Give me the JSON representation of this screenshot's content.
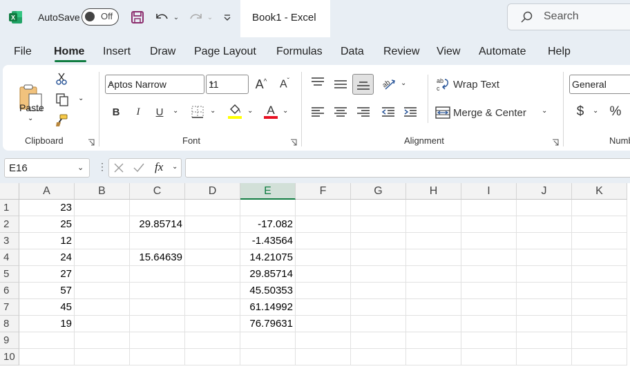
{
  "titlebar": {
    "autosave_label": "AutoSave",
    "autosave_state": "Off",
    "doc_title": "Book1  -  Excel",
    "search_placeholder": "Search"
  },
  "menu": [
    "File",
    "Home",
    "Insert",
    "Draw",
    "Page Layout",
    "Formulas",
    "Data",
    "Review",
    "View",
    "Automate",
    "Help"
  ],
  "menu_active": "Home",
  "ribbon": {
    "clipboard": {
      "paste_label": "Paste",
      "group_label": "Clipboard"
    },
    "font": {
      "font_name": "Aptos Narrow",
      "font_size": "11",
      "group_label": "Font",
      "bold": "B",
      "italic": "I",
      "underline": "U"
    },
    "alignment": {
      "wrap_text": "Wrap Text",
      "merge_center": "Merge & Center",
      "group_label": "Alignment"
    },
    "number": {
      "format": "General",
      "group_label": "Numb",
      "currency": "$",
      "percent": "%"
    }
  },
  "formula_bar": {
    "name_box": "E16",
    "formula": ""
  },
  "columns": [
    "A",
    "B",
    "C",
    "D",
    "E",
    "F",
    "G",
    "H",
    "I",
    "J",
    "K"
  ],
  "selected_column": "E",
  "rows": [
    "1",
    "2",
    "3",
    "4",
    "5",
    "6",
    "7",
    "8",
    "9",
    "10"
  ],
  "cells": {
    "A": [
      "23",
      "25",
      "12",
      "24",
      "27",
      "57",
      "45",
      "19",
      "",
      ""
    ],
    "C": [
      "",
      "29.85714",
      "",
      "15.64639",
      "",
      "",
      "",
      "",
      "",
      ""
    ],
    "E": [
      "",
      "-17.082",
      "-1.43564",
      "14.21075",
      "29.85714",
      "45.50353",
      "61.14992",
      "76.79631",
      "",
      ""
    ]
  },
  "colors": {
    "accent": "#107c41",
    "fill_yellow": "#ffff00",
    "font_red": "#e81123"
  }
}
